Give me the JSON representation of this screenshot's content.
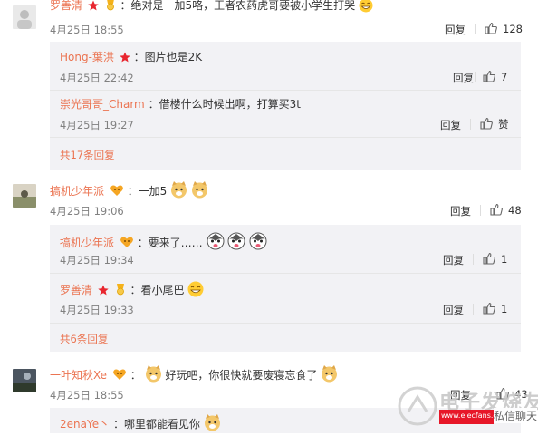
{
  "comments": [
    {
      "user": "罗善清",
      "text": "：绝对是一加5咯，王者农药虎哥要被小学生打哭",
      "time": "4月25日 18:55",
      "reply": "回复",
      "likes": "128",
      "replies": [
        {
          "user": "Hong-葉洪",
          "text": "：图片也是2K",
          "time": "4月25日 22:42",
          "reply": "回复",
          "likes": "7"
        },
        {
          "user": "崇光哥哥_Charm",
          "text": "：借楼什么时候出啊，打算买3t",
          "time": "4月25日 19:27",
          "reply": "回复",
          "likes": "赞"
        }
      ],
      "more": "共17条回复"
    },
    {
      "user": "搞机少年派",
      "text": "：一加5",
      "time": "4月25日 19:06",
      "reply": "回复",
      "likes": "48",
      "replies": [
        {
          "user": "搞机少年派",
          "text": "：要来了……",
          "time": "4月25日 19:34",
          "reply": "回复",
          "likes": "1"
        },
        {
          "user": "罗善清",
          "text": "：看小尾巴",
          "time": "4月25日 19:33",
          "reply": "回复",
          "likes": "1"
        }
      ],
      "more": "共6条回复"
    },
    {
      "user": "一叶知秋Xe",
      "text": "好玩吧，你很快就要废寝忘食了",
      "time": "4月25日 18:55",
      "reply": "回复",
      "likes": "43",
      "replies": [
        {
          "user": "2enaYe丶",
          "text": "：哪里都能看见你"
        }
      ]
    }
  ],
  "watermark": {
    "site": "电子发烧友",
    "domain": "www.elecfans.com",
    "chat": "私信聊天"
  },
  "colors": {
    "username": "#eb7350",
    "sub_bg": "#f2f2f5",
    "time": "#808080",
    "watermark": "#e60012"
  }
}
